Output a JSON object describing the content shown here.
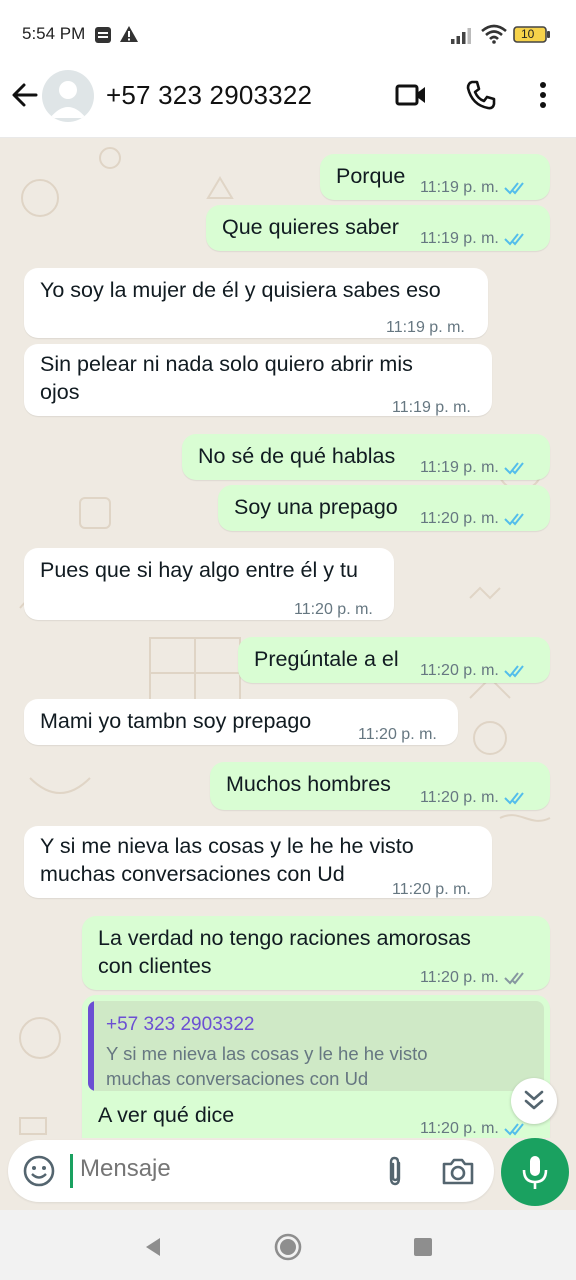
{
  "status_bar": {
    "time": "5:54 PM",
    "battery": "10",
    "icons": [
      "recording-icon",
      "warning-icon",
      "signal-icon",
      "wifi-icon",
      "battery-icon"
    ]
  },
  "header": {
    "contact_name": "+57 323 2903322",
    "icons": [
      "back-arrow-icon",
      "avatar-icon",
      "video-call-icon",
      "phone-icon",
      "more-options-icon"
    ]
  },
  "messages": [
    {
      "dir": "out",
      "text": "Porque",
      "time": "11:19 p. m.",
      "status": "read"
    },
    {
      "dir": "out",
      "text": "Que quieres saber",
      "time": "11:19 p. m.",
      "status": "read"
    },
    {
      "dir": "in",
      "text": "Yo soy la mujer de él y quisiera sabes eso",
      "time": "11:19 p. m."
    },
    {
      "dir": "in",
      "text_lines": [
        "Sin pelear ni nada solo quiero abrir mis",
        "ojos"
      ],
      "time": "11:19 p. m."
    },
    {
      "dir": "out",
      "text": "No sé de qué hablas",
      "time": "11:19 p. m.",
      "status": "read"
    },
    {
      "dir": "out",
      "text": "Soy una prepago",
      "time": "11:20 p. m.",
      "status": "read"
    },
    {
      "dir": "in",
      "text": "Pues que si hay algo entre él y tu",
      "time": "11:20 p. m."
    },
    {
      "dir": "out",
      "text": "Pregúntale a el",
      "time": "11:20 p. m.",
      "status": "read"
    },
    {
      "dir": "in",
      "text": "Mami yo tambn soy prepago",
      "time": "11:20 p. m."
    },
    {
      "dir": "out",
      "text": "Muchos hombres",
      "time": "11:20 p. m.",
      "status": "read"
    },
    {
      "dir": "in",
      "text_lines": [
        "Y si me nieva las cosas y le he he visto",
        "muchas conversaciones con Ud"
      ],
      "time": "11:20 p. m."
    },
    {
      "dir": "out",
      "text_lines": [
        "La verdad no tengo raciones amorosas",
        "con clientes"
      ],
      "time": "11:20 p. m.",
      "status": "delivered"
    },
    {
      "dir": "out",
      "quote": {
        "name": "+57 323 2903322",
        "lines": [
          "Y si me nieva las cosas y le he he visto",
          "muchas conversaciones con Ud"
        ]
      },
      "text": "A ver qué dice",
      "time": "11:20 p. m.",
      "status": "read"
    }
  ],
  "input": {
    "placeholder": "Mensaje",
    "icons": [
      "emoji-icon",
      "attach-icon",
      "camera-icon",
      "mic-icon"
    ]
  },
  "colors": {
    "chat_bg": "#efeae2",
    "outgoing_bubble": "#d9fdd3",
    "incoming_bubble": "#ffffff",
    "read_ticks": "#53bdeb",
    "accent_green": "#1aa160",
    "quote_name": "#6b4fd3"
  }
}
